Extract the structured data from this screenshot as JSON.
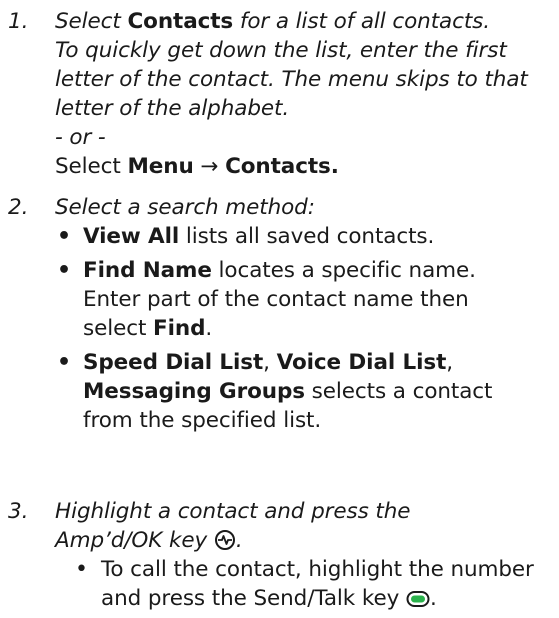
{
  "steps": [
    {
      "number": "1.",
      "lines": [
        [
          "Select ",
          "Contacts",
          " for a list of all contacts."
        ],
        "To quickly get down the list, enter the first",
        "letter of the contact. The menu skips to that",
        "letter of the alphabet."
      ],
      "or": "- or -",
      "alt": [
        "Select ",
        "Menu",
        " → ",
        "Contacts."
      ]
    },
    {
      "number": "2.",
      "intro": "Select a search method:",
      "bullets": [
        {
          "bold": "View All",
          "rest": " lists all saved contacts."
        },
        {
          "bold": "Find Name",
          "rest": " locates a specific name.",
          "extra": [
            "Enter part of the contact name then",
            "select ",
            "Find",
            "."
          ]
        },
        {
          "items": [
            "Speed Dial List",
            ", ",
            "Voice Dial List",
            ",",
            "Messaging Groups",
            " selects a contact",
            "from the specified list."
          ]
        }
      ]
    },
    {
      "number": "3.",
      "lines": [
        "Highlight a contact and press the",
        "Amp’d/OK key"
      ],
      "sub_bullet": [
        "To call the contact, highlight the number",
        "and press the Send/Talk key"
      ]
    }
  ],
  "icons": [
    "ampd-ok-key-icon",
    "send-talk-key-icon"
  ],
  "colors": {
    "text": "#1a1a1a",
    "talk_key_green": "#2bb24c"
  }
}
